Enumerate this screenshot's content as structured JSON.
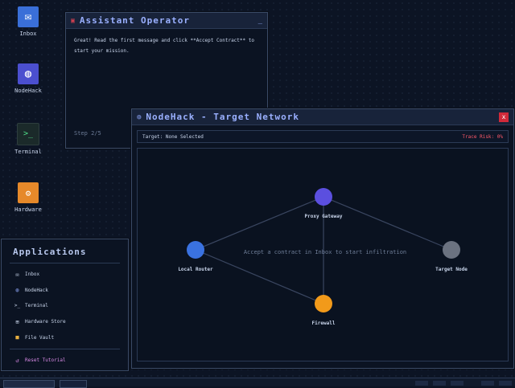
{
  "desktop": {
    "icons": [
      {
        "label": "Inbox",
        "icon": "mail-icon",
        "color": "#3a6fd8"
      },
      {
        "label": "NodeHack",
        "icon": "globe-icon",
        "color": "#4b4fcf"
      },
      {
        "label": "Terminal",
        "icon": "terminal-icon",
        "color": "#1b2a2a"
      },
      {
        "label": "Hardware",
        "icon": "hardware-icon",
        "color": "#e6892a"
      }
    ]
  },
  "assistant": {
    "title": "Assistant Operator",
    "message": "Great! Read the first message and click **Accept Contract** to start your mission.",
    "step": "Step 2/5",
    "minimize": "_"
  },
  "nodehack": {
    "title": "NodeHack - Target Network",
    "close": "x",
    "target": "Target: None Selected",
    "trace": "Trace Risk: 0%",
    "hint": "Accept a contract in Inbox to start infiltration",
    "nodes": [
      {
        "label": "Proxy Gateway",
        "color": "#5b4fdf"
      },
      {
        "label": "Local Router",
        "color": "#3a72e0"
      },
      {
        "label": "Target Node",
        "color": "#6b7280"
      },
      {
        "label": "Firewall",
        "color": "#f29a1a"
      }
    ]
  },
  "applications": {
    "title": "Applications",
    "items": [
      {
        "label": "Inbox",
        "icon": "mail-icon"
      },
      {
        "label": "NodeHack",
        "icon": "globe-icon"
      },
      {
        "label": "Terminal",
        "icon": "terminal-icon"
      },
      {
        "label": "Hardware Store",
        "icon": "store-icon"
      },
      {
        "label": "File Vault",
        "icon": "folder-icon"
      }
    ],
    "reset": "Reset Tutorial"
  }
}
